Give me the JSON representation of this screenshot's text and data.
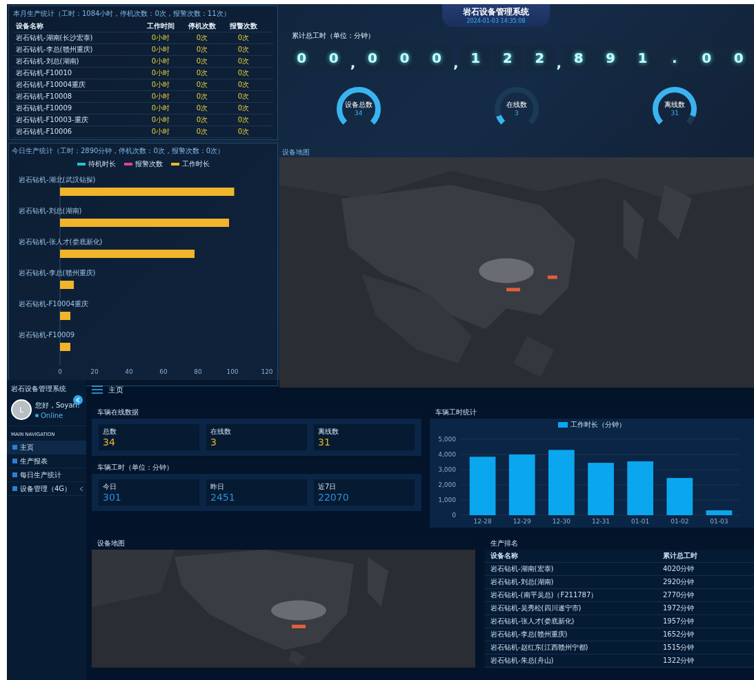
{
  "header": {
    "title": "岩石设备管理系统",
    "subtitle": "2024-01-03 14:35:08"
  },
  "production_table": {
    "title": "本月生产统计（工时：1084小时，停机次数：0次，报警次数：11次）",
    "columns": [
      "设备名称",
      "工作时间",
      "停机次数",
      "报警次数"
    ],
    "rows": [
      {
        "name": "岩石钻机-湖南(长沙宏泰)",
        "hours": "0小时",
        "stops": "0次",
        "alarms": "0次"
      },
      {
        "name": "岩石钻机-李总(赣州重庆)",
        "hours": "0小时",
        "stops": "0次",
        "alarms": "0次"
      },
      {
        "name": "岩石钻机-刘总(湖南)",
        "hours": "0小时",
        "stops": "0次",
        "alarms": "0次"
      },
      {
        "name": "岩石钻机-F10010",
        "hours": "0小时",
        "stops": "0次",
        "alarms": "0次"
      },
      {
        "name": "岩石钻机-F10004重庆",
        "hours": "0小时",
        "stops": "0次",
        "alarms": "0次"
      },
      {
        "name": "岩石钻机-F10008",
        "hours": "0小时",
        "stops": "0次",
        "alarms": "0次"
      },
      {
        "name": "岩石钻机-F10009",
        "hours": "0小时",
        "stops": "0次",
        "alarms": "0次"
      },
      {
        "name": "岩石钻机-F10003-重庆",
        "hours": "0小时",
        "stops": "0次",
        "alarms": "0次"
      },
      {
        "name": "岩石钻机-F10006",
        "hours": "0小时",
        "stops": "0次",
        "alarms": "0次"
      }
    ]
  },
  "daily_chart": {
    "title": "今日生产统计（工时：2890分钟，停机次数：0次，报警次数：0次）",
    "chart_data": {
      "type": "bar",
      "orientation": "horizontal",
      "categories": [
        "岩石钻机-湖北(武汉钻探)",
        "岩石钻机-刘总(湖南)",
        "岩石钻机-张人才(娄底新化)",
        "岩石钻机-李总(赣州重庆)",
        "岩石钻机-F10004重庆",
        "岩石钻机-F10009"
      ],
      "series": [
        {
          "name": "待机时长",
          "color": "#1ec8d8",
          "values": [
            0,
            0,
            0,
            0,
            0,
            0
          ]
        },
        {
          "name": "报警次数",
          "color": "#e0409a",
          "values": [
            0,
            0,
            0,
            0,
            0,
            0
          ]
        },
        {
          "name": "工作时长",
          "color": "#f0b52a",
          "values": [
            101,
            98,
            78,
            8,
            6,
            6
          ]
        }
      ],
      "xlim": [
        0,
        120
      ],
      "xticks": [
        0,
        20,
        40,
        60,
        80,
        100,
        120
      ]
    }
  },
  "counter": {
    "label": "累计总工时（单位：分钟）",
    "cells": [
      {
        "kind": "digit",
        "text": "0"
      },
      {
        "kind": "digit",
        "text": "0"
      },
      {
        "kind": "sep",
        "text": ","
      },
      {
        "kind": "digit",
        "text": "0"
      },
      {
        "kind": "digit",
        "text": "0"
      },
      {
        "kind": "digit",
        "text": "0"
      },
      {
        "kind": "sep",
        "text": ","
      },
      {
        "kind": "digit",
        "text": "1"
      },
      {
        "kind": "digit",
        "text": "2"
      },
      {
        "kind": "digit",
        "text": "2"
      },
      {
        "kind": "sep",
        "text": ","
      },
      {
        "kind": "digit",
        "text": "8"
      },
      {
        "kind": "digit",
        "text": "9"
      },
      {
        "kind": "digit",
        "text": "1"
      },
      {
        "kind": "digit",
        "text": "."
      },
      {
        "kind": "digit",
        "text": "0"
      },
      {
        "kind": "digit",
        "text": "0"
      }
    ]
  },
  "gauges": [
    {
      "label": "设备总数",
      "value": "34"
    },
    {
      "label": "在线数",
      "value": "3"
    },
    {
      "label": "离线数",
      "value": "31"
    }
  ],
  "device_map": {
    "title": "设备地图"
  },
  "sidebar": {
    "app_name": "岩石设备管理系统",
    "user": {
      "initial": "L",
      "greeting": "您好，Soyan!",
      "status": "Online"
    },
    "section": "MAIN NAVIGATION",
    "items": [
      {
        "label": "主页",
        "selected": true,
        "expandable": false
      },
      {
        "label": "生产报表",
        "selected": false,
        "expandable": false
      },
      {
        "label": "每日生产统计",
        "selected": false,
        "expandable": false
      },
      {
        "label": "设备管理（4G）",
        "selected": false,
        "expandable": true
      }
    ]
  },
  "page": {
    "title": "主页"
  },
  "online_card": {
    "title": "车辆在线数据",
    "stats": [
      {
        "label": "总数",
        "value": "34"
      },
      {
        "label": "在线数",
        "value": "3"
      },
      {
        "label": "离线数",
        "value": "31"
      }
    ]
  },
  "hours_card": {
    "title": "车辆工时（单位：分钟）",
    "stats": [
      {
        "label": "今日",
        "value": "301"
      },
      {
        "label": "昨日",
        "value": "2451"
      },
      {
        "label": "近7日",
        "value": "22070"
      }
    ]
  },
  "weekly_chart": {
    "title": "车辆工时统计",
    "chart_data": {
      "type": "bar",
      "categories": [
        "12-28",
        "12-29",
        "12-30",
        "12-31",
        "01-01",
        "01-02",
        "01-03"
      ],
      "series": [
        {
          "name": "工作时长（分钟）",
          "color": "#0aa7ef",
          "values": [
            3850,
            4000,
            4300,
            3450,
            3550,
            2450,
            320
          ]
        }
      ],
      "ylim": [
        0,
        5000
      ],
      "grid": true,
      "yticks": [
        {
          "value": 0,
          "label": "0"
        },
        {
          "value": 1000,
          "label": "1,000"
        },
        {
          "value": 2000,
          "label": "2,000"
        },
        {
          "value": 3000,
          "label": "3,000"
        },
        {
          "value": 4000,
          "label": "4,000"
        },
        {
          "value": 5000,
          "label": "5,000"
        }
      ]
    }
  },
  "map_panel": {
    "title": "设备地图"
  },
  "ranking": {
    "title": "生产排名",
    "columns": [
      "设备名称",
      "累计总工时"
    ],
    "rows": [
      {
        "name": "岩石钻机-湖南(宏泰)",
        "minutes": "4020分钟"
      },
      {
        "name": "岩石钻机-刘总(湖南)",
        "minutes": "2920分钟"
      },
      {
        "name": "岩石钻机-(南平吴总)（F211787）",
        "minutes": "2770分钟"
      },
      {
        "name": "岩石钻机-吴秀松(四川遂宁市)",
        "minutes": "1972分钟"
      },
      {
        "name": "岩石钻机-张人才(娄底新化)",
        "minutes": "1957分钟"
      },
      {
        "name": "岩石钻机-李总(赣州重庆)",
        "minutes": "1652分钟"
      },
      {
        "name": "岩石钻机-赵红东(江西赣州宁都)",
        "minutes": "1515分钟"
      },
      {
        "name": "岩石钻机-朱总(舟山)",
        "minutes": "1322分钟"
      }
    ]
  }
}
